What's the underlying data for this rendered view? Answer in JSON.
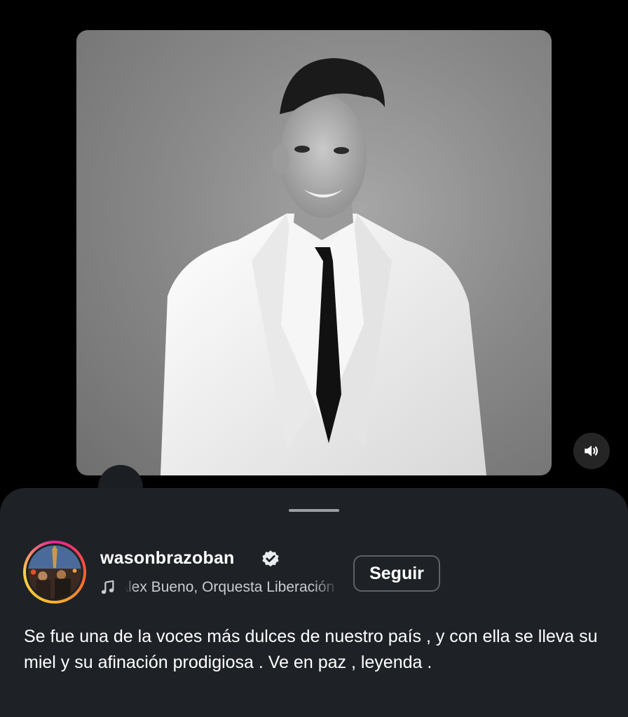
{
  "media": {
    "description_icon": "photo",
    "sound_icon": "volume-icon"
  },
  "post": {
    "username": "wasonbrazoban",
    "verified_icon": "verified-badge-icon",
    "audio_text": "Alex Bueno, Orquesta Liberación",
    "follow_label": "Seguir",
    "caption": "Se fue una de la voces más dulces de nuestro país , y con ella se lleva su miel y su afinación prodigiosa . Ve en paz , leyenda ."
  },
  "colors": {
    "sheet_bg": "#1e2226",
    "follow_border": "#5d6268",
    "ring_start": "#e6209a",
    "ring_end": "#ffd04a"
  }
}
